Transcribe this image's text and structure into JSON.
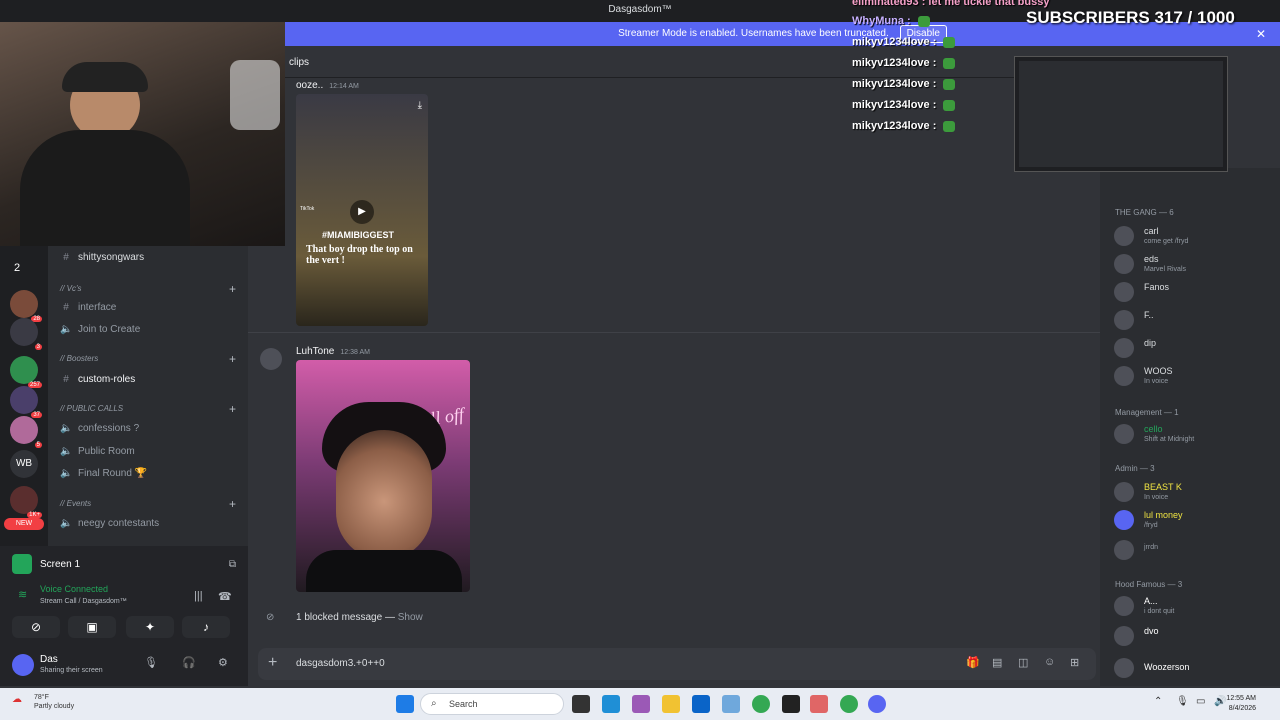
{
  "window": {
    "title": "Dasgasdom™"
  },
  "banner": {
    "text": "Streamer Mode is enabled. Usernames have been truncated.",
    "disable_label": "Disable"
  },
  "overlay": {
    "subs": "SUBSCRIBERS 317 / 1000",
    "chat": [
      {
        "user": "eliminated93",
        "msg": "let me tickle that bussy"
      },
      {
        "user": "WhyMuna",
        "msg": ""
      },
      {
        "user": "mikyv1234love",
        "msg": ""
      },
      {
        "user": "mikyv1234love",
        "msg": ""
      },
      {
        "user": "mikyv1234love",
        "msg": ""
      },
      {
        "user": "mikyv1234love",
        "msg": ""
      },
      {
        "user": "mikyv1234love",
        "msg": ""
      }
    ]
  },
  "rail": {
    "folder_count": "2",
    "badges": [
      "28",
      "3",
      "257",
      "37",
      "5",
      "1K+"
    ],
    "wb_label": "WB",
    "new_label": "NEW"
  },
  "channels": {
    "top": "shittysongwars",
    "cat_vcs": "// Vc's",
    "interface": "interface",
    "join_to_create": "Join to Create",
    "cat_boosters": "// Boosters",
    "custom_roles": "custom-roles",
    "cat_public": "// PUBLIC CALLS",
    "confessions": "confessions ?",
    "public_room": "Public Room",
    "final_round": "Final Round 🏆",
    "cat_events": "// Events",
    "neegy": "neegy contestants"
  },
  "voice": {
    "screen_label": "Screen 1",
    "connected": "Voice Connected",
    "location": "Stream Call / Dasgasdom™",
    "user_name": "Das",
    "user_status": "Sharing their screen"
  },
  "chat": {
    "channel": "clips",
    "msg1": {
      "author": "ooze..",
      "time": "12:14 AM",
      "tag": "#MIAMIBIGGEST",
      "caption": "That boy drop the top on the vert !",
      "tiktok": "TikTok"
    },
    "msg2": {
      "author": "LuhTone",
      "time": "12:38 AM",
      "neon": "I fell off"
    },
    "blocked": "1 blocked message —",
    "blocked_show": "Show",
    "composer_value": "dasgasdom3.+0++0"
  },
  "members": {
    "gang_header": "THE GANG — 6",
    "gang": [
      {
        "name": "carl",
        "status": "come get /fryd",
        "color": "#8e9297"
      },
      {
        "name": "eds",
        "status": "Marvel Rivals",
        "color": "#8e9297"
      },
      {
        "name": "Fanos",
        "status": "",
        "color": "#8e9297"
      },
      {
        "name": "F..",
        "status": "",
        "color": "#8e9297"
      },
      {
        "name": "dip",
        "status": "",
        "color": "#8e9297"
      },
      {
        "name": "WOOS",
        "status": "In voice",
        "color": "#8e9297"
      }
    ],
    "mgmt_header": "Management — 1",
    "mgmt": [
      {
        "name": "cello",
        "status": "Shift at Midnight",
        "color": "#23a55a"
      }
    ],
    "admin_header": "Admin — 3",
    "admin": [
      {
        "name": "BEAST K",
        "status": "In voice",
        "color": "#f0e442"
      },
      {
        "name": "lul money",
        "status": "/fryd",
        "color": "#f0e442"
      },
      {
        "name": "",
        "status": "jrrdn",
        "color": "#f0e442"
      }
    ],
    "hood_header": "Hood Famous — 3",
    "hood": [
      {
        "name": "A...",
        "status": "i dont quit",
        "color": "#ffffff"
      },
      {
        "name": "dvo",
        "status": "",
        "color": "#ffffff"
      },
      {
        "name": "Woozerson",
        "status": "",
        "color": "#ffffff"
      }
    ]
  },
  "taskbar": {
    "temp": "78°F",
    "weather": "Partly cloudy",
    "search": "Search",
    "time": "12:55 AM",
    "date": "8/4/2026"
  }
}
